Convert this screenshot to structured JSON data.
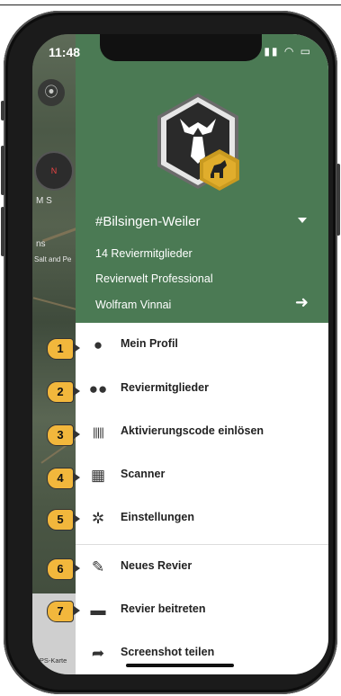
{
  "status_bar": {
    "time": "11:48"
  },
  "map": {
    "labels": [
      "M S",
      "ns",
      "Salt and Pe",
      "GPS-Karte"
    ]
  },
  "drawer": {
    "header_bg": "#4b7a54",
    "revier_name": "#Bilsingen-Weiler",
    "members": "14 Reviermitglieder",
    "plan": "Revierwelt Professional",
    "user": "Wolfram Vinnai",
    "menu": [
      {
        "label": "Mein Profil",
        "icon": "person-icon",
        "badge": "1"
      },
      {
        "label": "Reviermitglieder",
        "icon": "group-icon",
        "badge": "2"
      },
      {
        "label": "Aktivierungscode einlösen",
        "icon": "barcode-icon",
        "badge": "3"
      },
      {
        "label": "Scanner",
        "icon": "qr-code-icon",
        "badge": "4"
      },
      {
        "label": "Einstellungen",
        "icon": "gear-icon",
        "badge": "5"
      },
      {
        "label": "Neues Revier",
        "icon": "pencil-icon",
        "badge": "6"
      },
      {
        "label": "Revier beitreten",
        "icon": "folder-add-icon",
        "badge": "7"
      },
      {
        "label": "Screenshot teilen",
        "icon": "share-icon",
        "badge": ""
      }
    ]
  },
  "colors": {
    "badge": "#f2b73c",
    "accent_gold": "#e0ad2c"
  }
}
